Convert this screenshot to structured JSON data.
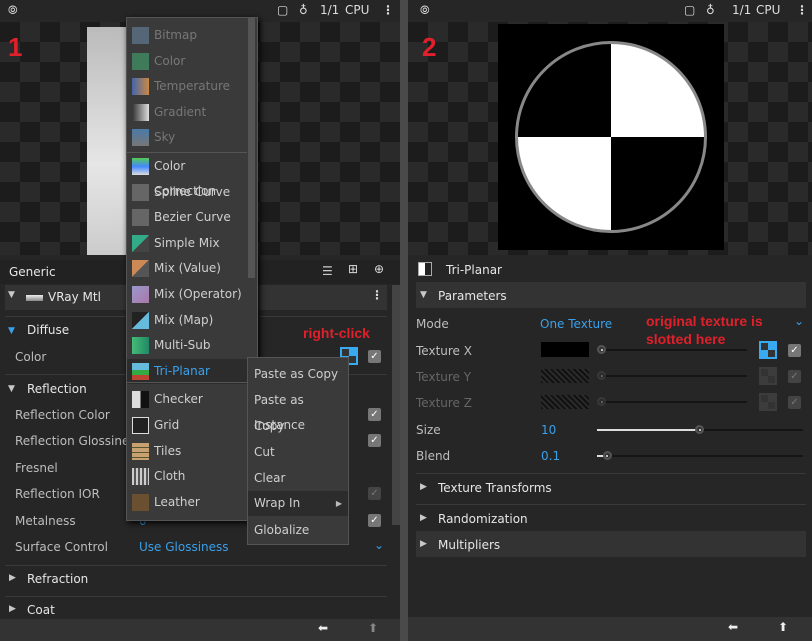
{
  "toolbar": {
    "render_mode_icon": "teapot-icon",
    "ratio": "1/1",
    "engine": "CPU",
    "menu_icon": "more-vertical-icon"
  },
  "panel1": {
    "label": "1",
    "header": "Generic",
    "material": "VRay Mtl",
    "sections": {
      "diffuse": "Diffuse",
      "reflection": "Reflection",
      "refraction": "Refraction",
      "coat": "Coat"
    },
    "params": {
      "color": "Color",
      "refl_color": "Reflection Color",
      "refl_gloss": "Reflection Glossiness",
      "fresnel": "Fresnel",
      "refl_ior": "Reflection IOR",
      "metalness": "Metalness",
      "metalness_value": "0",
      "surface_control": "Surface Control",
      "surface_control_value": "Use Glossiness"
    },
    "annotation": "right-click",
    "texture_menu": [
      {
        "label": "Bitmap",
        "enabled": false
      },
      {
        "label": "Color",
        "enabled": false
      },
      {
        "label": "Temperature",
        "enabled": false
      },
      {
        "label": "Gradient",
        "enabled": false
      },
      {
        "label": "Sky",
        "enabled": false
      },
      {
        "label": "Color Correction",
        "enabled": true
      },
      {
        "label": "Spline Curve",
        "enabled": true
      },
      {
        "label": "Bezier Curve",
        "enabled": true
      },
      {
        "label": "Simple Mix",
        "enabled": true
      },
      {
        "label": "Mix (Value)",
        "enabled": true
      },
      {
        "label": "Mix (Operator)",
        "enabled": true
      },
      {
        "label": "Mix (Map)",
        "enabled": true
      },
      {
        "label": "Multi-Sub",
        "enabled": true
      },
      {
        "label": "Tri-Planar",
        "enabled": true,
        "selected": true
      },
      {
        "label": "Checker",
        "enabled": true
      },
      {
        "label": "Grid",
        "enabled": true
      },
      {
        "label": "Tiles",
        "enabled": true
      },
      {
        "label": "Cloth",
        "enabled": true
      },
      {
        "label": "Leather",
        "enabled": true
      }
    ],
    "context_menu": [
      "Paste as Copy",
      "Paste as Instance",
      "Copy",
      "Cut",
      "Clear",
      "Wrap In",
      "Globalize"
    ]
  },
  "panel2": {
    "label": "2",
    "header": "Tri-Planar",
    "parameters": "Parameters",
    "mode_label": "Mode",
    "mode_value": "One Texture",
    "texture_x": "Texture X",
    "texture_y": "Texture Y",
    "texture_z": "Texture Z",
    "size_label": "Size",
    "size_value": "10",
    "size_fraction": 0.5,
    "blend_label": "Blend",
    "blend_value": "0.1",
    "blend_fraction": 0.1,
    "annotation": "original texture is slotted here",
    "texture_transforms": "Texture Transforms",
    "randomization": "Randomization",
    "multipliers": "Multipliers"
  },
  "colors": {
    "accent": "#3aa0ea",
    "annotation": "#e0202a"
  }
}
